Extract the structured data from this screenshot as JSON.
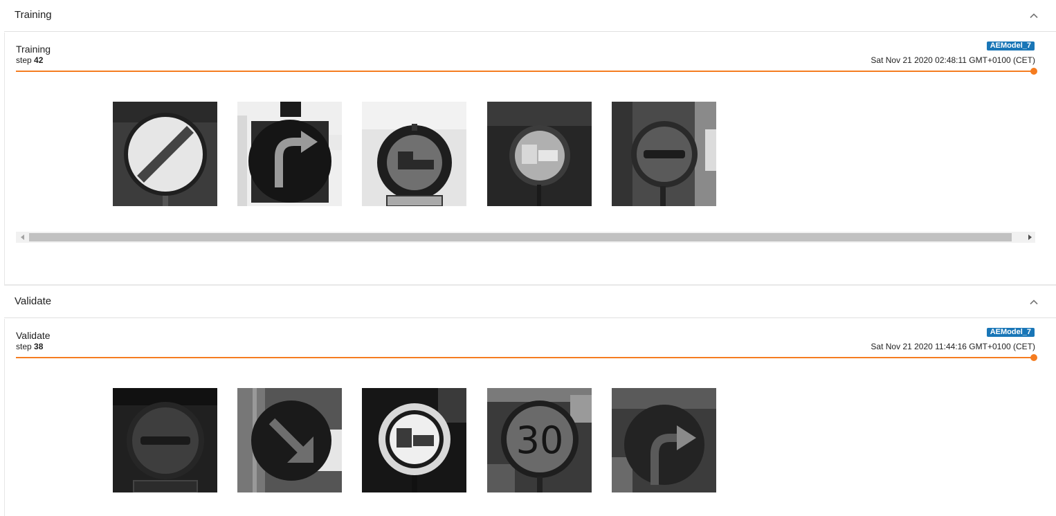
{
  "sections": [
    {
      "header": "Training",
      "card": {
        "title": "Training",
        "step_label": "step",
        "step_value": "42",
        "run_tag": "AEModel_7",
        "wall_time": "Sat Nov 21 2020 02:48:11 GMT+0100 (CET)",
        "slider_position": 1.0,
        "images": [
          "end-of-restrictions sign",
          "turn-right sign",
          "no-trucks sign",
          "no-trucks sign",
          "no-overtaking sign"
        ]
      }
    },
    {
      "header": "Validate",
      "card": {
        "title": "Validate",
        "step_label": "step",
        "step_value": "38",
        "run_tag": "AEModel_7",
        "wall_time": "Sat Nov 21 2020 11:44:16 GMT+0100 (CET)",
        "slider_position": 1.0,
        "images": [
          "no-overtaking sign",
          "keep-right sign",
          "no-trucks sign",
          "speed-limit sign",
          "turn-right sign"
        ],
        "speed_limit_text": "30"
      }
    }
  ],
  "icons": {
    "collapse": "chevron-up-icon",
    "scroll_left": "triangle-left-icon",
    "scroll_right": "triangle-right-icon"
  },
  "colors": {
    "accent": "#f57c20",
    "tag": "#1976b7"
  }
}
